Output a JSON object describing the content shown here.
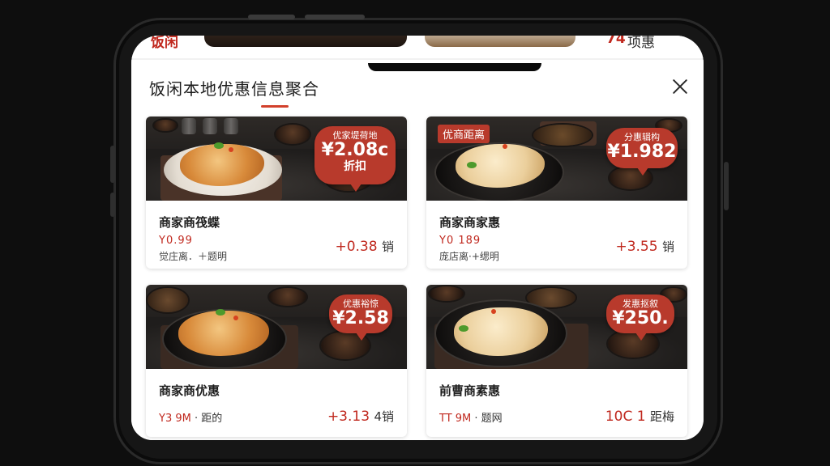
{
  "background": {
    "left_label": "饭闲",
    "right_label_accent": "74",
    "right_label": "项惠"
  },
  "header": {
    "title": "饭闲本地优惠信息聚合"
  },
  "cards": [
    {
      "badge_top": "优家堤荷地",
      "badge_price": "¥2.08c",
      "badge_sub": "折扣",
      "name": "商家商筏蝶",
      "line1": "Y0.99",
      "line2": "觉庄离．＋题明",
      "right_value": "+0.38",
      "right_unit": "销"
    },
    {
      "tag": "优商距离",
      "badge_top": "分惠辑构",
      "badge_price": "¥1.982",
      "name": "商家商家惠",
      "line1": "Y0 189",
      "line2": "庞店离·+缌明",
      "right_value": "+3.55",
      "right_unit": "销"
    },
    {
      "badge_top": "优惠裕惊",
      "badge_price": "¥2.58",
      "name": "商家商优惠",
      "line_price": "Y3 9M",
      "line_rest": "· 距的",
      "right_value": "+3.13",
      "right_unit": "4销"
    },
    {
      "badge_top": "发惠抠叙",
      "badge_price": "¥250.",
      "name": "前曹商素惠",
      "line_price": "TT 9M",
      "line_rest": "· 题网",
      "right_value": "10C 1",
      "right_unit": "距梅"
    }
  ]
}
